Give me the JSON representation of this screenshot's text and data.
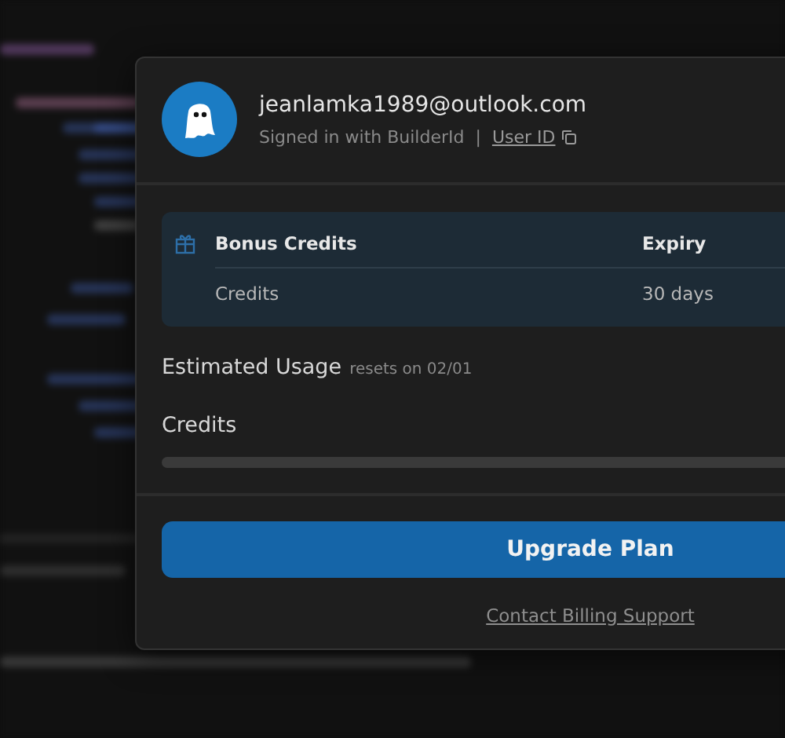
{
  "account": {
    "email": "jeanlamka1989@outlook.com",
    "signed_in": "Signed in with BuilderId",
    "separator": "|",
    "user_id_link": "User ID"
  },
  "bonus_table": {
    "columns": [
      "Bonus Credits",
      "Expiry"
    ],
    "rows": [
      {
        "name": "Credits",
        "expiry": "30 days"
      }
    ]
  },
  "usage": {
    "title": "Estimated Usage",
    "note": "resets on 02/01",
    "meters": [
      {
        "label": "Credits",
        "level": 0
      }
    ]
  },
  "upgrade_button": "Upgrade Plan",
  "support_link": "Contact Billing Support"
}
